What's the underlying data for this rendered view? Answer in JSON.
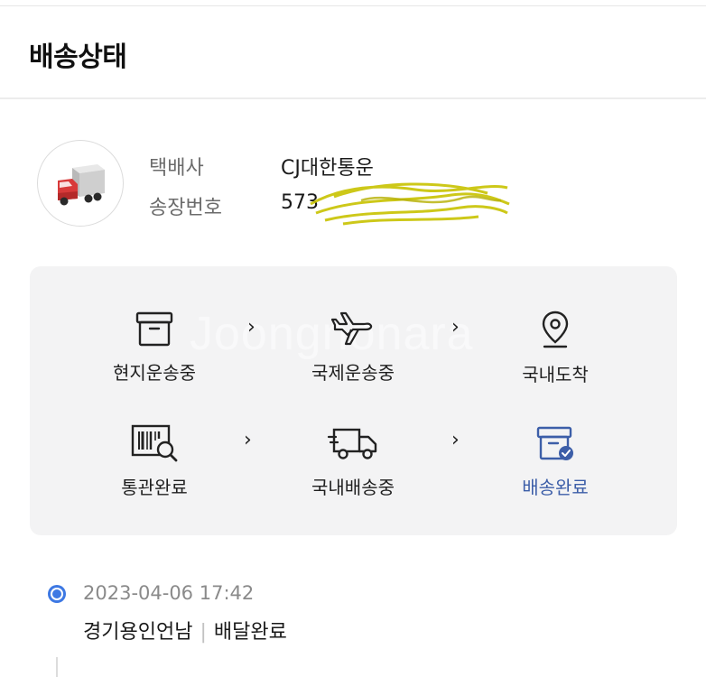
{
  "header": {
    "title": "배송상태"
  },
  "courier": {
    "icon": "delivery-truck-icon",
    "company_label": "택배사",
    "company_value": "CJ대한통운",
    "tracking_label": "송장번호",
    "tracking_value": "573"
  },
  "watermark": "Joongnonara",
  "steps": [
    {
      "label": "현지운송중",
      "icon": "box-icon"
    },
    {
      "label": "국제운송중",
      "icon": "airplane-icon"
    },
    {
      "label": "국내도착",
      "icon": "location-pin-icon"
    },
    {
      "label": "통관완료",
      "icon": "barcode-search-icon"
    },
    {
      "label": "국내배송중",
      "icon": "truck-icon"
    },
    {
      "label": "배송완료",
      "icon": "box-check-icon",
      "active": true
    }
  ],
  "colors": {
    "active": "#3c5ea8",
    "dot": "#3d78e3",
    "panel": "#f3f3f4"
  },
  "timeline": [
    {
      "datetime": "2023-04-06 17:42",
      "location": "경기용인언남",
      "status": "배달완료"
    }
  ]
}
